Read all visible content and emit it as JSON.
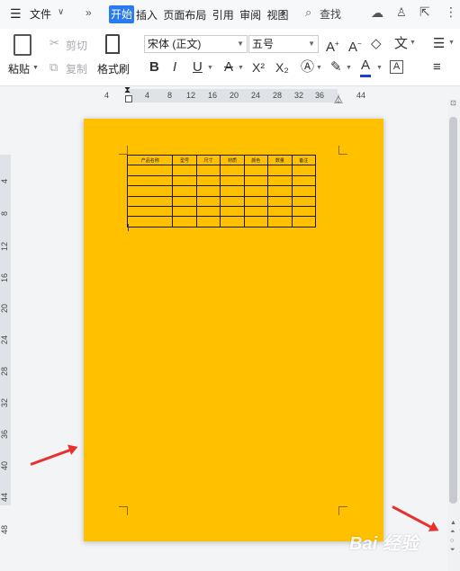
{
  "menubar": {
    "file_label": "文件",
    "tabs": [
      "开始",
      "插入",
      "页面布局",
      "引用",
      "审阅",
      "视图"
    ],
    "search_label": "查找"
  },
  "toolbar": {
    "paste_label": "粘贴",
    "cut_label": "剪切",
    "copy_label": "复制",
    "format_painter_label": "格式刷",
    "font_name": "宋体 (正文)",
    "font_size": "五号",
    "bold": "B",
    "italic": "I",
    "underline": "U",
    "superscript": "X²",
    "subscript": "X₂"
  },
  "ruler": {
    "h_ticks": [
      "4",
      "4",
      "8",
      "12",
      "16",
      "20",
      "24",
      "28",
      "32",
      "36",
      "44"
    ],
    "v_ticks": [
      "4",
      "8",
      "12",
      "16",
      "20",
      "24",
      "28",
      "32",
      "36",
      "40",
      "44",
      "48"
    ]
  },
  "document": {
    "table_headers": [
      "产品名称",
      "型号",
      "尺寸",
      "材质",
      "颜色",
      "数量",
      "备注"
    ],
    "empty_rows": 6
  },
  "watermark": "Bai 经验",
  "colors": {
    "page_bg": "#ffc000",
    "accent": "#2b7bf0",
    "arrow": "#e8312f"
  }
}
